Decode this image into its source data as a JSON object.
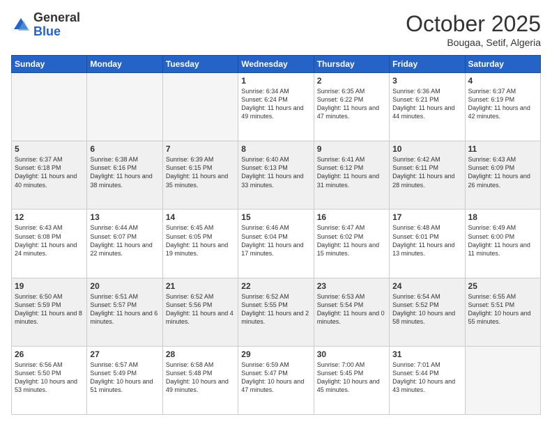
{
  "logo": {
    "general": "General",
    "blue": "Blue"
  },
  "header": {
    "month": "October 2025",
    "location": "Bougaa, Setif, Algeria"
  },
  "weekdays": [
    "Sunday",
    "Monday",
    "Tuesday",
    "Wednesday",
    "Thursday",
    "Friday",
    "Saturday"
  ],
  "weeks": [
    [
      {
        "day": "",
        "empty": true
      },
      {
        "day": "",
        "empty": true
      },
      {
        "day": "",
        "empty": true
      },
      {
        "day": "1",
        "sunrise": "6:34 AM",
        "sunset": "6:24 PM",
        "daylight": "11 hours and 49 minutes."
      },
      {
        "day": "2",
        "sunrise": "6:35 AM",
        "sunset": "6:22 PM",
        "daylight": "11 hours and 47 minutes."
      },
      {
        "day": "3",
        "sunrise": "6:36 AM",
        "sunset": "6:21 PM",
        "daylight": "11 hours and 44 minutes."
      },
      {
        "day": "4",
        "sunrise": "6:37 AM",
        "sunset": "6:19 PM",
        "daylight": "11 hours and 42 minutes."
      }
    ],
    [
      {
        "day": "5",
        "sunrise": "6:37 AM",
        "sunset": "6:18 PM",
        "daylight": "11 hours and 40 minutes."
      },
      {
        "day": "6",
        "sunrise": "6:38 AM",
        "sunset": "6:16 PM",
        "daylight": "11 hours and 38 minutes."
      },
      {
        "day": "7",
        "sunrise": "6:39 AM",
        "sunset": "6:15 PM",
        "daylight": "11 hours and 35 minutes."
      },
      {
        "day": "8",
        "sunrise": "6:40 AM",
        "sunset": "6:13 PM",
        "daylight": "11 hours and 33 minutes."
      },
      {
        "day": "9",
        "sunrise": "6:41 AM",
        "sunset": "6:12 PM",
        "daylight": "11 hours and 31 minutes."
      },
      {
        "day": "10",
        "sunrise": "6:42 AM",
        "sunset": "6:11 PM",
        "daylight": "11 hours and 28 minutes."
      },
      {
        "day": "11",
        "sunrise": "6:43 AM",
        "sunset": "6:09 PM",
        "daylight": "11 hours and 26 minutes."
      }
    ],
    [
      {
        "day": "12",
        "sunrise": "6:43 AM",
        "sunset": "6:08 PM",
        "daylight": "11 hours and 24 minutes."
      },
      {
        "day": "13",
        "sunrise": "6:44 AM",
        "sunset": "6:07 PM",
        "daylight": "11 hours and 22 minutes."
      },
      {
        "day": "14",
        "sunrise": "6:45 AM",
        "sunset": "6:05 PM",
        "daylight": "11 hours and 19 minutes."
      },
      {
        "day": "15",
        "sunrise": "6:46 AM",
        "sunset": "6:04 PM",
        "daylight": "11 hours and 17 minutes."
      },
      {
        "day": "16",
        "sunrise": "6:47 AM",
        "sunset": "6:02 PM",
        "daylight": "11 hours and 15 minutes."
      },
      {
        "day": "17",
        "sunrise": "6:48 AM",
        "sunset": "6:01 PM",
        "daylight": "11 hours and 13 minutes."
      },
      {
        "day": "18",
        "sunrise": "6:49 AM",
        "sunset": "6:00 PM",
        "daylight": "11 hours and 11 minutes."
      }
    ],
    [
      {
        "day": "19",
        "sunrise": "6:50 AM",
        "sunset": "5:59 PM",
        "daylight": "11 hours and 8 minutes."
      },
      {
        "day": "20",
        "sunrise": "6:51 AM",
        "sunset": "5:57 PM",
        "daylight": "11 hours and 6 minutes."
      },
      {
        "day": "21",
        "sunrise": "6:52 AM",
        "sunset": "5:56 PM",
        "daylight": "11 hours and 4 minutes."
      },
      {
        "day": "22",
        "sunrise": "6:52 AM",
        "sunset": "5:55 PM",
        "daylight": "11 hours and 2 minutes."
      },
      {
        "day": "23",
        "sunrise": "6:53 AM",
        "sunset": "5:54 PM",
        "daylight": "11 hours and 0 minutes."
      },
      {
        "day": "24",
        "sunrise": "6:54 AM",
        "sunset": "5:52 PM",
        "daylight": "10 hours and 58 minutes."
      },
      {
        "day": "25",
        "sunrise": "6:55 AM",
        "sunset": "5:51 PM",
        "daylight": "10 hours and 55 minutes."
      }
    ],
    [
      {
        "day": "26",
        "sunrise": "6:56 AM",
        "sunset": "5:50 PM",
        "daylight": "10 hours and 53 minutes."
      },
      {
        "day": "27",
        "sunrise": "6:57 AM",
        "sunset": "5:49 PM",
        "daylight": "10 hours and 51 minutes."
      },
      {
        "day": "28",
        "sunrise": "6:58 AM",
        "sunset": "5:48 PM",
        "daylight": "10 hours and 49 minutes."
      },
      {
        "day": "29",
        "sunrise": "6:59 AM",
        "sunset": "5:47 PM",
        "daylight": "10 hours and 47 minutes."
      },
      {
        "day": "30",
        "sunrise": "7:00 AM",
        "sunset": "5:45 PM",
        "daylight": "10 hours and 45 minutes."
      },
      {
        "day": "31",
        "sunrise": "7:01 AM",
        "sunset": "5:44 PM",
        "daylight": "10 hours and 43 minutes."
      },
      {
        "day": "",
        "empty": true
      }
    ]
  ]
}
